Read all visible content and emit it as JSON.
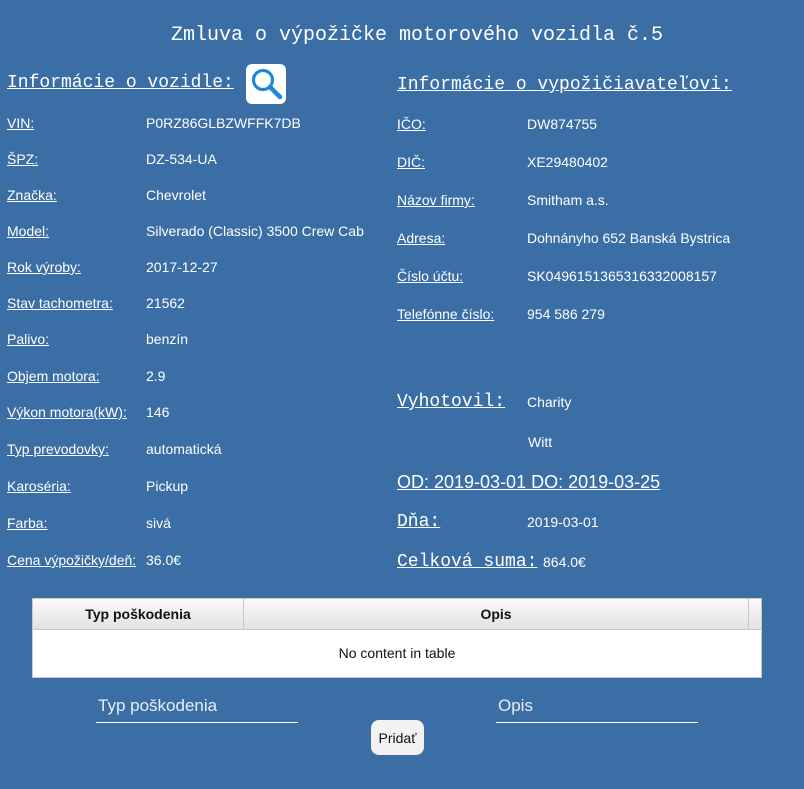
{
  "title": "Zmluva o výpožičke motorového vozidla č.5",
  "vehicle": {
    "heading": "Informácie o vozidle:",
    "rows": [
      {
        "label": "VIN:",
        "value": "P0RZ86GLBZWFFK7DB"
      },
      {
        "label": "ŠPZ:",
        "value": "DZ-534-UA"
      },
      {
        "label": "Značka:",
        "value": "Chevrolet"
      },
      {
        "label": "Model:",
        "value": "Silverado (Classic) 3500 Crew Cab"
      },
      {
        "label": "Rok výroby:",
        "value": "2017-12-27"
      },
      {
        "label": "Stav tachometra:",
        "value": "21562"
      },
      {
        "label": "Palivo:",
        "value": "benzín"
      },
      {
        "label": "Objem motora:",
        "value": "2.9"
      },
      {
        "label": "Výkon motora(kW):",
        "value": "146"
      },
      {
        "label": "Typ prevodovky:",
        "value": "automatická"
      },
      {
        "label": "Karoséria:",
        "value": "Pickup"
      },
      {
        "label": "Farba:",
        "value": "sivá"
      },
      {
        "label": "Cena výpožičky/deň:",
        "value": "36.0€"
      }
    ]
  },
  "borrower": {
    "heading": "Informácie o vypožičiavateľovi:",
    "rows": [
      {
        "label": "IČO:",
        "value": "DW874755"
      },
      {
        "label": "DIČ:",
        "value": "XE29480402"
      },
      {
        "label": "Názov firmy:",
        "value": "Smitham a.s."
      },
      {
        "label": "Adresa:",
        "value": "Dohnányho 652 Banská Bystrica"
      },
      {
        "label": "Číslo účtu:",
        "value": "SK0496151365316332008157"
      },
      {
        "label": "Telefónne číslo:",
        "value": "954 586 279"
      }
    ]
  },
  "issued_by": {
    "label": "Vyhotovil:",
    "first_name": "Charity",
    "last_name": "Witt"
  },
  "period": "OD: 2019-03-01 DO: 2019-03-25",
  "date": {
    "label": "Dňa:",
    "value": "2019-03-01"
  },
  "total": {
    "label": "Celková suma:",
    "value": "864.0€"
  },
  "damage_table": {
    "columns": [
      "Typ poškodenia",
      "Opis"
    ],
    "empty_message": "No content in table"
  },
  "form": {
    "type_placeholder": "Typ poškodenia",
    "description_placeholder": "Opis",
    "add_label": "Pridať"
  },
  "icons": {
    "search": "search-icon"
  },
  "colors": {
    "background": "#3a6ea5",
    "search_icon": "#1e88d8"
  }
}
